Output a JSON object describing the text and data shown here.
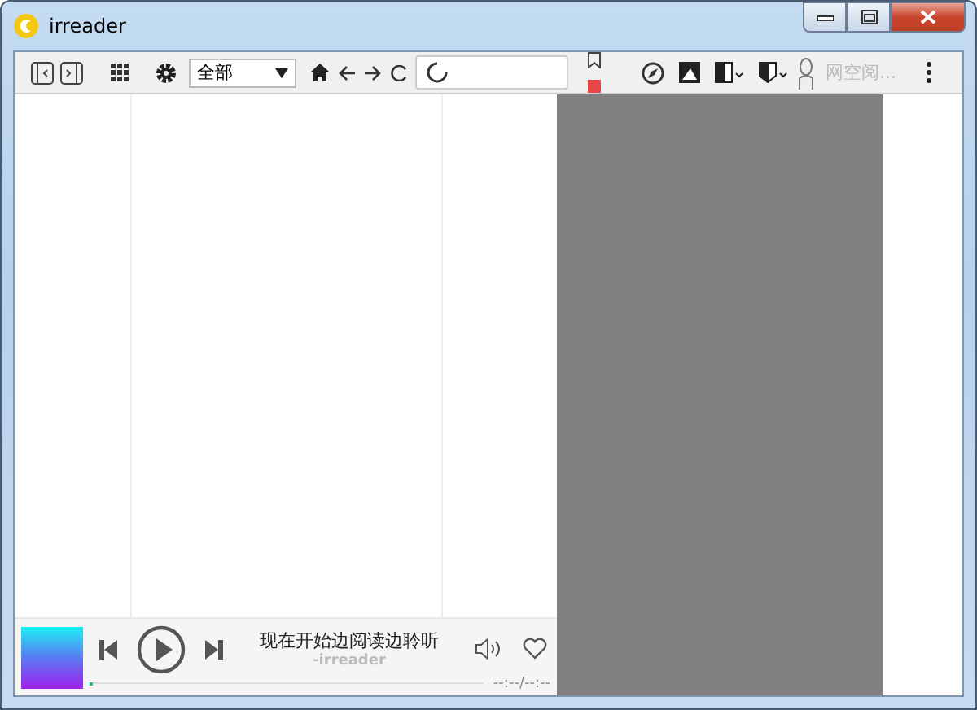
{
  "window": {
    "title": "irreader"
  },
  "toolbar": {
    "filter_select": {
      "value": "全部"
    },
    "search_placeholder": "网空阅..."
  },
  "player": {
    "title": "现在开始边阅读边聆听",
    "artist": "-irreader",
    "time": "--:--/--:--",
    "level": 0.01,
    "playing": false
  }
}
